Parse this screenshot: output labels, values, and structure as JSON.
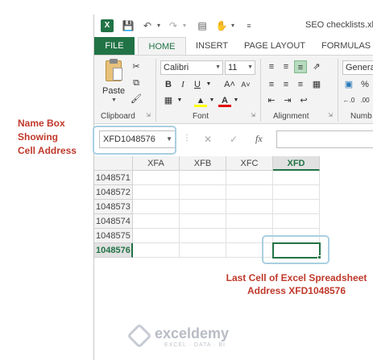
{
  "window": {
    "title": "SEO checklists.xlsx"
  },
  "quick_access": {
    "save_icon": "save-icon",
    "undo_icon": "undo-icon",
    "redo_icon": "redo-icon",
    "form_icon": "form-icon",
    "touch_icon": "touch-mode-icon",
    "customize_icon": "customize-icon"
  },
  "tabs": {
    "file": "FILE",
    "home": "HOME",
    "insert": "INSERT",
    "page_layout": "PAGE LAYOUT",
    "formulas": "FORMULAS"
  },
  "ribbon": {
    "clipboard": {
      "label": "Clipboard",
      "paste": "Paste"
    },
    "font": {
      "label": "Font",
      "name": "Calibri",
      "size": "11",
      "bold": "B",
      "italic": "I",
      "underline": "U",
      "grow": "A˄",
      "shrink": "A˅"
    },
    "alignment": {
      "label": "Alignment"
    },
    "number": {
      "label": "Numb",
      "format": "Genera",
      "format_label": ".00",
      "decrease": "→.0"
    }
  },
  "formula_bar": {
    "name_box": "XFD1048576",
    "cancel": "✕",
    "enter": "✓",
    "fx": "fx",
    "value": ""
  },
  "grid": {
    "columns": [
      "XFA",
      "XFB",
      "XFC",
      "XFD"
    ],
    "active_column": "XFD",
    "rows": [
      "1048571",
      "1048572",
      "1048573",
      "1048574",
      "1048575",
      "1048576"
    ],
    "active_row": "1048576",
    "active_cell": "XFD1048576"
  },
  "annotations": {
    "name_box_note": [
      "Name Box",
      "Showing",
      "Cell Address"
    ],
    "last_cell_note": [
      "Last Cell of Excel Spreadsheet",
      "Address XFD1048576"
    ]
  },
  "watermark": {
    "name": "exceldemy",
    "tagline": "EXCEL · DATA · BI"
  },
  "colors": {
    "excel_green": "#217346",
    "annotation_red": "#c0392b",
    "callout_blue": "#a9cfe0"
  }
}
